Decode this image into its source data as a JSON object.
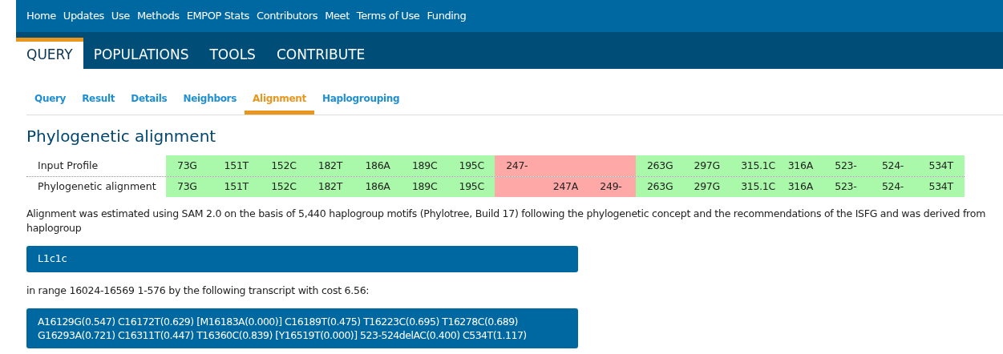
{
  "top_nav": [
    "Home",
    "Updates",
    "Use",
    "Methods",
    "EMPOP Stats",
    "Contributors",
    "Meet",
    "Terms of Use",
    "Funding"
  ],
  "main_tabs": [
    {
      "label": "QUERY",
      "selected": true
    },
    {
      "label": "POPULATIONS",
      "selected": false
    },
    {
      "label": "TOOLS",
      "selected": false
    },
    {
      "label": "CONTRIBUTE",
      "selected": false
    }
  ],
  "sub_tabs": [
    {
      "label": "Query",
      "selected": false
    },
    {
      "label": "Result",
      "selected": false
    },
    {
      "label": "Details",
      "selected": false
    },
    {
      "label": "Neighbors",
      "selected": false
    },
    {
      "label": "Alignment",
      "selected": true
    },
    {
      "label": "Haplogrouping",
      "selected": false
    }
  ],
  "heading": "Phylogenetic alignment",
  "alignment_rows": [
    {
      "label": "Input Profile",
      "cells": [
        {
          "text": "73G",
          "match": true
        },
        {
          "text": "151T",
          "match": true
        },
        {
          "text": "152C",
          "match": true
        },
        {
          "text": "182T",
          "match": true
        },
        {
          "text": "186A",
          "match": true
        },
        {
          "text": "189C",
          "match": true
        },
        {
          "text": "195C",
          "match": true
        },
        {
          "text": "247-",
          "match": false
        },
        {
          "match": false
        },
        {
          "match": false
        },
        {
          "text": "263G",
          "match": true
        },
        {
          "text": "297G",
          "match": true
        },
        {
          "text": "315.1C",
          "match": true
        },
        {
          "text": "316A",
          "match": true
        },
        {
          "text": "523-",
          "match": true
        },
        {
          "text": "524-",
          "match": true
        },
        {
          "text": "534T",
          "match": true
        }
      ]
    },
    {
      "label": "Phylogenetic alignment",
      "cells": [
        {
          "text": "73G",
          "match": true
        },
        {
          "text": "151T",
          "match": true
        },
        {
          "text": "152C",
          "match": true
        },
        {
          "text": "182T",
          "match": true
        },
        {
          "text": "186A",
          "match": true
        },
        {
          "text": "189C",
          "match": true
        },
        {
          "text": "195C",
          "match": true
        },
        {
          "match": false
        },
        {
          "text": "247A",
          "match": false
        },
        {
          "text": "249-",
          "match": false
        },
        {
          "text": "263G",
          "match": true
        },
        {
          "text": "297G",
          "match": true
        },
        {
          "text": "315.1C",
          "match": true
        },
        {
          "text": "316A",
          "match": true
        },
        {
          "text": "523-",
          "match": true
        },
        {
          "text": "524-",
          "match": true
        },
        {
          "text": "534T",
          "match": true
        }
      ]
    }
  ],
  "description": "Alignment was estimated using SAM 2.0 on the basis of 5,440 haplogroup motifs (Phylotree, Build 17) following the phylogenetic concept and the recommendations of the ISFG and was derived from haplogroup",
  "haplogroup": "L1c1c",
  "range_text": "in range 16024-16569 1-576 by the following transcript with cost 6.56:",
  "transcript_lines": [
    "A16129G(0.547) C16172T(0.629) [M16183A(0.000)] C16189T(0.475) T16223C(0.695) T16278C(0.689)",
    "G16293A(0.721) C16311T(0.447) T16360C(0.839) [Y16519T(0.000)] 523-524delAC(0.400) C534T(1.117)"
  ]
}
